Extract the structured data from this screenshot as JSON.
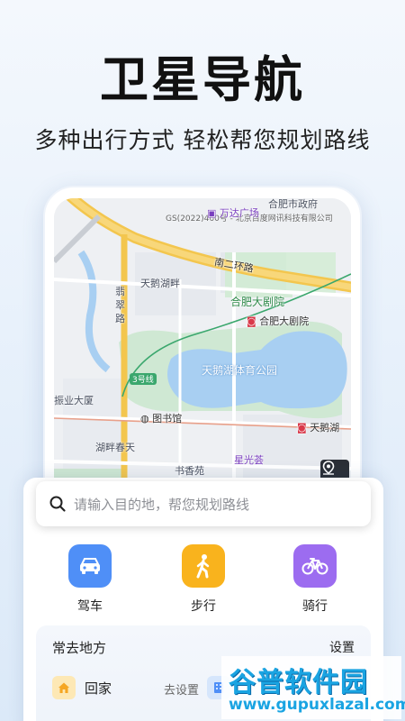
{
  "headline": "卫星导航",
  "subline": "多种出行方式 轻松帮您规划路线",
  "map": {
    "copyright": "GS(2022)460号 - 北京百度网讯科技有限公司",
    "labels": {
      "wanda": "万达广场",
      "hefei_gov": "合肥市政府",
      "ring_road": "南二环路",
      "tiane_lake_shore": "天鹅湖畔",
      "cuiwei_road": "翡翠路",
      "grand_theater_area": "合肥大剧院",
      "grand_theater_poi": "合肥大剧院",
      "line3": "3号线",
      "sports_park": "天鹅湖体育公园",
      "zhenye": "振业大厦",
      "library": "图书馆",
      "tiane_lake_station": "天鹅湖",
      "hupan_chuntian": "湖畔春天",
      "shuxiangyuan": "书香苑",
      "xingguang": "星光荟"
    }
  },
  "search": {
    "placeholder": "请输入目的地，帮您规划路线"
  },
  "modes": [
    {
      "label": "驾车",
      "icon": "car-icon",
      "color": "#4f8ff7"
    },
    {
      "label": "步行",
      "icon": "walk-icon",
      "color": "#f9b31d"
    },
    {
      "label": "骑行",
      "icon": "bike-icon",
      "color": "#9c6cf0"
    }
  ],
  "frequent": {
    "title": "常去地方",
    "settings": "设置",
    "home_label": "回家",
    "home_action": "去设置"
  },
  "watermark": {
    "title": "谷普软件园",
    "url": "www.gupuxlazal.com"
  }
}
